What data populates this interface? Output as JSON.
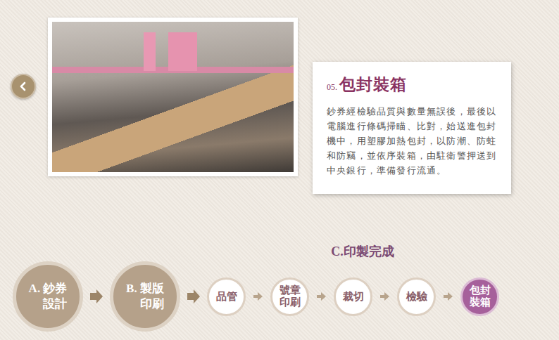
{
  "step_detail": {
    "number": "05.",
    "title": "包封裝箱",
    "description": "鈔券經檢驗品質與數量無誤後，最後以電腦進行條碼掃瞄、比對，始送進包封機中，用塑膠加熱包封，以防潮、防蛀和防竊，並依序裝箱，由駐衛警押送到中央銀行，準備發行流通。"
  },
  "stage_group_title": "C.印製完成",
  "stages": [
    {
      "lines": [
        "A. 鈔券",
        "設計"
      ],
      "kind": "major",
      "selected": false
    },
    {
      "lines": [
        "B. 製版",
        "印刷"
      ],
      "kind": "major",
      "selected": false
    },
    {
      "lines": [
        "品管"
      ],
      "kind": "minor",
      "selected": false
    },
    {
      "lines": [
        "號章",
        "印刷"
      ],
      "kind": "minor",
      "selected": false
    },
    {
      "lines": [
        "裁切"
      ],
      "kind": "minor",
      "selected": false
    },
    {
      "lines": [
        "檢驗"
      ],
      "kind": "minor",
      "selected": false
    },
    {
      "lines": [
        "包封",
        "裝箱"
      ],
      "kind": "minor",
      "selected": true
    }
  ]
}
